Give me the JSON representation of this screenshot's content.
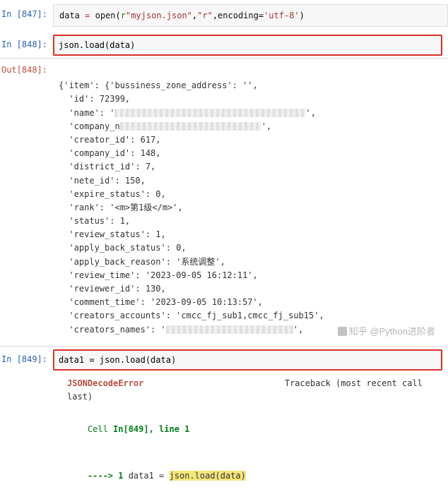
{
  "cells": {
    "c847": {
      "prompt": "In [847]:",
      "code_parts": {
        "var": "data",
        "eq": " = ",
        "open": "open",
        "lp": "(",
        "r": "r",
        "str": "\"myjson.json\"",
        "comma1": ",",
        "mode": "\"r\"",
        "comma2": ",",
        "enc_kw": "encoding",
        "enc_eq": "=",
        "enc": "'utf-8'",
        "rp": ")"
      }
    },
    "c848": {
      "prompt": "In [848]:",
      "code": "json.load(data)",
      "out_prompt": "Out[848]:",
      "output_lines": [
        "{'item': {'bussiness_zone_address': '',",
        "  'id': 72399,",
        "  'name': '",
        "  'company_n",
        "  'creator_id': 617,",
        "  'company_id': 148,",
        "  'district_id': 7,",
        "  'nete_id': 150,",
        "  'expire_status': 0,",
        "  'rank': '<m>第1级</m>',",
        "  'status': 1,",
        "  'review_status': 1,",
        "  'apply_back_status': 0,",
        "  'apply_back_reason': '系统调整',",
        "  'review_time': '2023-09-05 16:12:11',",
        "  'reviewer_id': 130,",
        "  'comment_time': '2023-09-05 10:13:57',",
        "  'creators_accounts': 'cmcc_fj_sub1,cmcc_fj_sub15',",
        "  'creators_names': '"
      ]
    },
    "c849": {
      "prompt": "In [849]:",
      "code": "data1 = json.load(data)",
      "error": {
        "name": "JSONDecodeError",
        "traceback": "Traceback (most recent call last)",
        "cell_ref": "Cell In[849], line 1",
        "arrow": "----> 1",
        "line_pre": " data1 = ",
        "line_hl": "json.load(data)"
      }
    }
  },
  "watermark": "知乎 @Python进阶者"
}
